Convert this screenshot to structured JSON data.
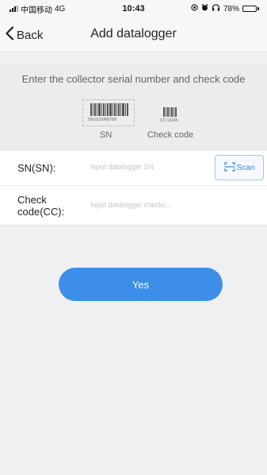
{
  "status_bar": {
    "carrier": "中国移动",
    "network": "4G",
    "time": "10:43",
    "battery": "78%",
    "battery_level": 0.78,
    "icons": [
      "signal-icon",
      "location-icon",
      "alarm-icon",
      "headphones-icon",
      "battery-icon"
    ]
  },
  "nav": {
    "back_label": "Back",
    "title": "Add datalogger",
    "back_icon": "chevron-left-icon"
  },
  "instructions": {
    "text": "Enter the collector serial number and check code",
    "sn_sample_code": "SN:0123456789",
    "cc_sample_code": "CC:12345",
    "sn_caption": "SN",
    "cc_caption": "Check code"
  },
  "form": {
    "sn": {
      "label": "SN(SN):",
      "value": "",
      "placeholder": "Input datalogger SN"
    },
    "cc": {
      "label": "Check code(CC):",
      "value": "",
      "placeholder": "Input datalogger checkc..."
    },
    "scan_label": "Scan",
    "scan_icon": "scan-frame-icon"
  },
  "submit_label": "Yes",
  "colors": {
    "accent": "#3d8ee8",
    "background": "#f0f0f2",
    "panel": "#ececee",
    "row": "#ffffff"
  }
}
